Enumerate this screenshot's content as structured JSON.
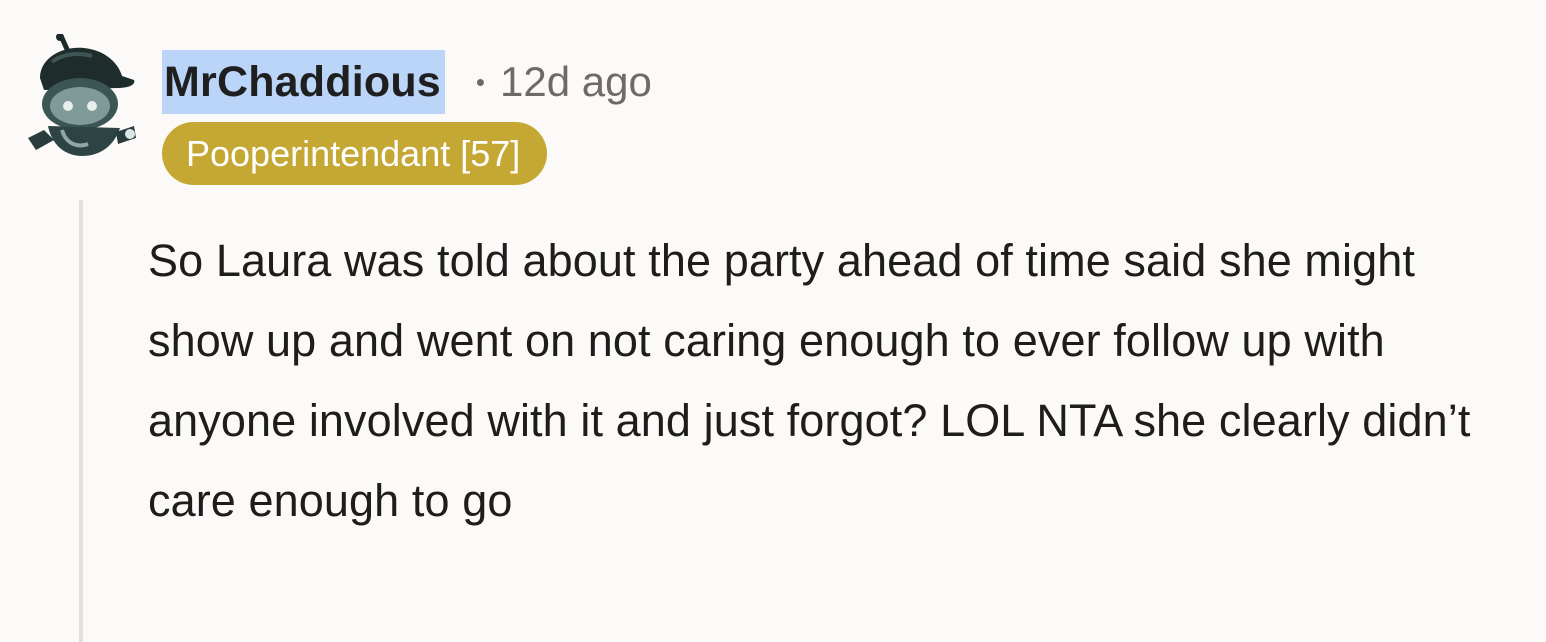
{
  "comment": {
    "username": "MrChaddious",
    "separator": "•",
    "timestamp": "12d ago",
    "flair": "Pooperintendant [57]",
    "text": "So Laura was told about the party ahead of time said she might show up and went on not caring enough to ever follow up with anyone involved with it and just forgot? LOL NTA she clearly didn’t care enough to go",
    "avatar_icon": "snoo-avatar-icon"
  },
  "colors": {
    "background": "#fbfaf8",
    "username_highlight": "#bad5f7",
    "flair_background": "#c5a834",
    "flair_text": "#ffffff",
    "meta_text": "#6f6a66",
    "body_text": "#1e1d1c",
    "thread_line": "#e6e0da"
  }
}
